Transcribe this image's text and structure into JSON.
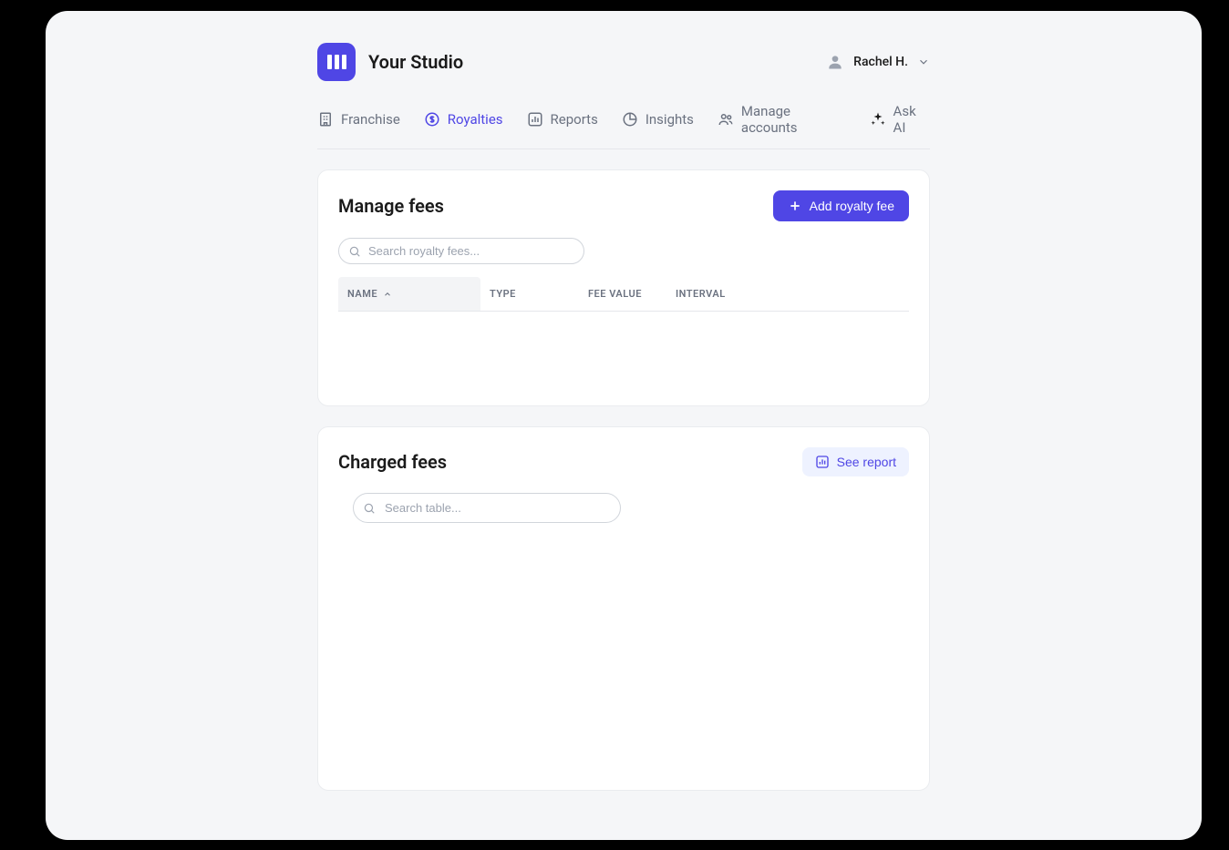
{
  "brand": {
    "title": "Your Studio"
  },
  "user": {
    "name": "Rachel H."
  },
  "tabs": [
    {
      "label": "Franchise",
      "active": false
    },
    {
      "label": "Royalties",
      "active": true
    },
    {
      "label": "Reports",
      "active": false
    },
    {
      "label": "Insights",
      "active": false
    },
    {
      "label": "Manage accounts",
      "active": false
    },
    {
      "label": "Ask AI",
      "active": false
    }
  ],
  "manageFees": {
    "title": "Manage fees",
    "addButton": "Add royalty fee",
    "searchPlaceholder": "Search royalty fees...",
    "columns": {
      "name": "NAME",
      "type": "TYPE",
      "feeValue": "FEE VALUE",
      "interval": "INTERVAL"
    }
  },
  "chargedFees": {
    "title": "Charged fees",
    "reportButton": "See report",
    "searchPlaceholder": "Search table..."
  },
  "colors": {
    "accent": "#4f46e5",
    "accentLight": "#eef2ff"
  }
}
